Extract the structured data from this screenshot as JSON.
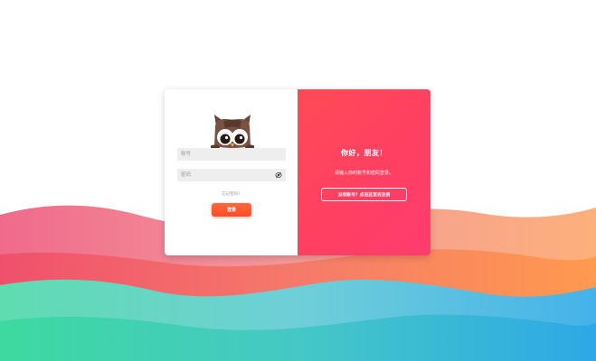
{
  "colors": {
    "primary": "#ff4a56",
    "login_button": "#ff5a2f",
    "input_bg": "#eeeeee"
  },
  "login": {
    "account_placeholder": "账号",
    "password_placeholder": "密码",
    "forgot_link": "忘记密码?",
    "login_button": "登录",
    "mascot_icon": "owl-mascot",
    "password_toggle_icon": "eye-off-icon"
  },
  "welcome": {
    "greeting": "你好，朋友！",
    "subtext": "请输入你的账号和密码登录。",
    "register_button": "没有账号？点击这里去注册"
  }
}
